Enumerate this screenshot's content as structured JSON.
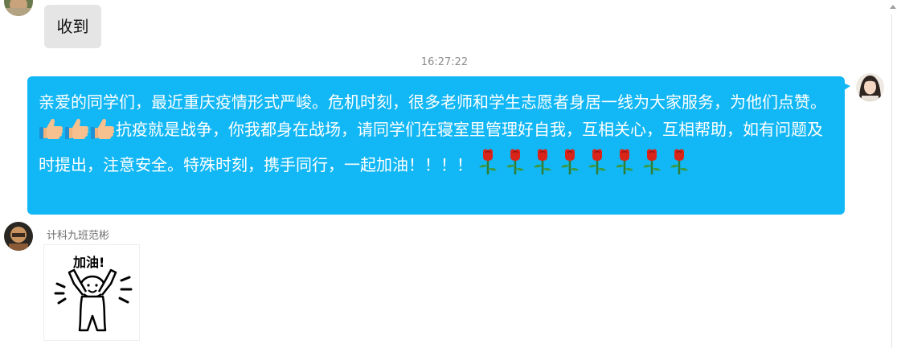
{
  "messages": {
    "top_reply": {
      "text": "收到"
    },
    "timestamp": "16:27:22",
    "self_message": {
      "segments": {
        "part1": "亲爱的同学们，最近重庆疫情形式严峻。危机时刻，很多老师和学生志愿者身居一线为大家服务，为他们点赞。",
        "part2": "抗疫就是战争，你我都身在战场，请同学们在寝室里管理好自我，互相关心，互相帮助，如有问题及时提出，注意安全。特殊时刻，携手同行，一起加油！！！！"
      },
      "thumbs_count": 3,
      "rose_count": 8,
      "bubble_color": "#12b7f5"
    },
    "sticker_message": {
      "sender": "计科九班范彬",
      "sticker_text": "加油!"
    }
  },
  "icons": {
    "thumbs": "thumbs-up-icon",
    "rose": "rose-icon"
  }
}
